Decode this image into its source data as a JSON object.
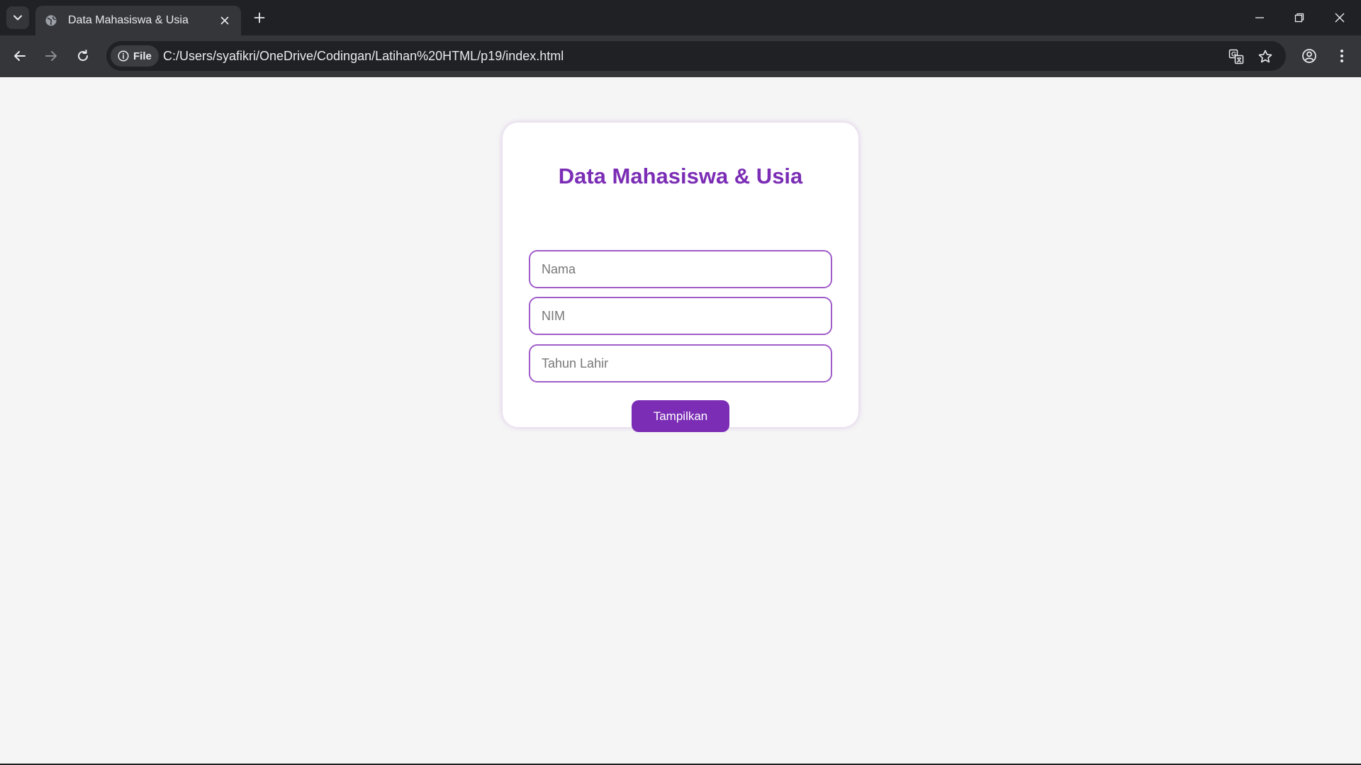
{
  "browser": {
    "tab_title": "Data Mahasiswa & Usia",
    "site_chip_label": "File",
    "url": "C:/Users/syafikri/OneDrive/Codingan/Latihan%20HTML/p19/index.html"
  },
  "form": {
    "title": "Data Mahasiswa & Usia",
    "nama_placeholder": "Nama",
    "nim_placeholder": "NIM",
    "tahun_lahir_placeholder": "Tahun Lahir",
    "submit_label": "Tampilkan"
  },
  "colors": {
    "accent": "#7b2db5",
    "border": "#a05cc9",
    "page_bg": "#f5f5f5"
  }
}
